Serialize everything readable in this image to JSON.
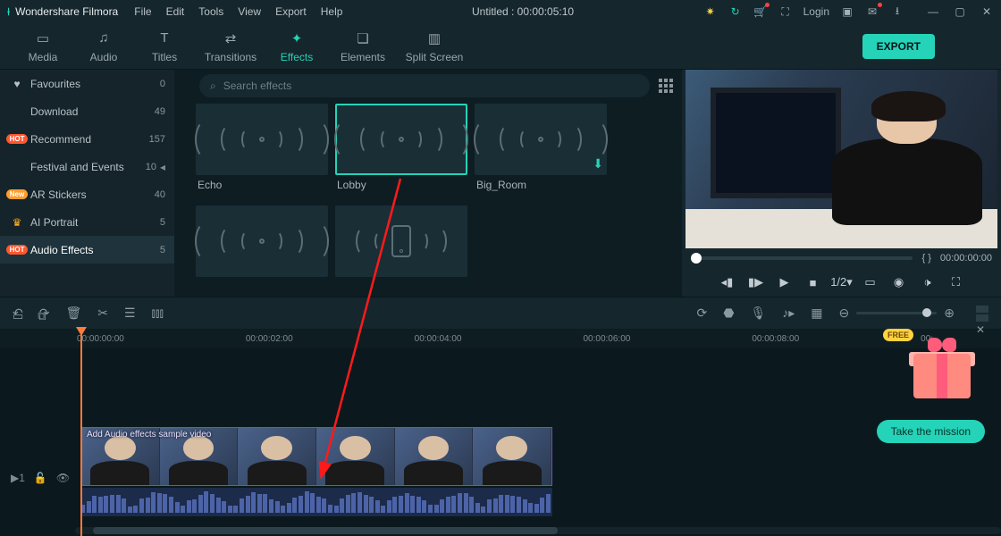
{
  "titlebar": {
    "appname": "Wondershare Filmora",
    "menus": [
      "File",
      "Edit",
      "Tools",
      "View",
      "Export",
      "Help"
    ],
    "doc_title": "Untitled : 00:00:05:10",
    "login": "Login"
  },
  "tabs": {
    "items": [
      {
        "label": "Media",
        "icon": "folder"
      },
      {
        "label": "Audio",
        "icon": "music"
      },
      {
        "label": "Titles",
        "icon": "T"
      },
      {
        "label": "Transitions",
        "icon": "swap"
      },
      {
        "label": "Effects",
        "icon": "sparkle",
        "active": true
      },
      {
        "label": "Elements",
        "icon": "shapes"
      },
      {
        "label": "Split Screen",
        "icon": "split"
      }
    ],
    "export_label": "EXPORT"
  },
  "sidebar": {
    "items": [
      {
        "icon": "heart",
        "label": "Favourites",
        "count": "0"
      },
      {
        "icon": "",
        "label": "Download",
        "count": "49"
      },
      {
        "icon": "hot",
        "label": "Recommend",
        "count": "157"
      },
      {
        "icon": "",
        "label": "Festival and Events",
        "count": "10"
      },
      {
        "icon": "new",
        "label": "AR Stickers",
        "count": "40"
      },
      {
        "icon": "crown",
        "label": "AI Portrait",
        "count": "5"
      },
      {
        "icon": "hot",
        "label": "Audio Effects",
        "count": "5",
        "active": true
      }
    ]
  },
  "search": {
    "placeholder": "Search effects"
  },
  "effects": {
    "row1": [
      {
        "label": "Echo"
      },
      {
        "label": "Lobby",
        "selected": true
      },
      {
        "label": "Big_Room",
        "download": true
      }
    ],
    "row2": [
      {
        "label": ""
      },
      {
        "label": "",
        "phone": true
      }
    ]
  },
  "preview": {
    "time_brackets": "{    }",
    "timecode": "00:00:00:00",
    "speed": "1/2"
  },
  "ruler": {
    "marks": [
      "00:00:00:00",
      "00:00:02:00",
      "00:00:04:00",
      "00:00:06:00",
      "00:00:08:00",
      "00:"
    ]
  },
  "clip": {
    "label": "Add Audio effects sample video"
  },
  "mission": {
    "free": "FREE",
    "button": "Take the mission"
  }
}
